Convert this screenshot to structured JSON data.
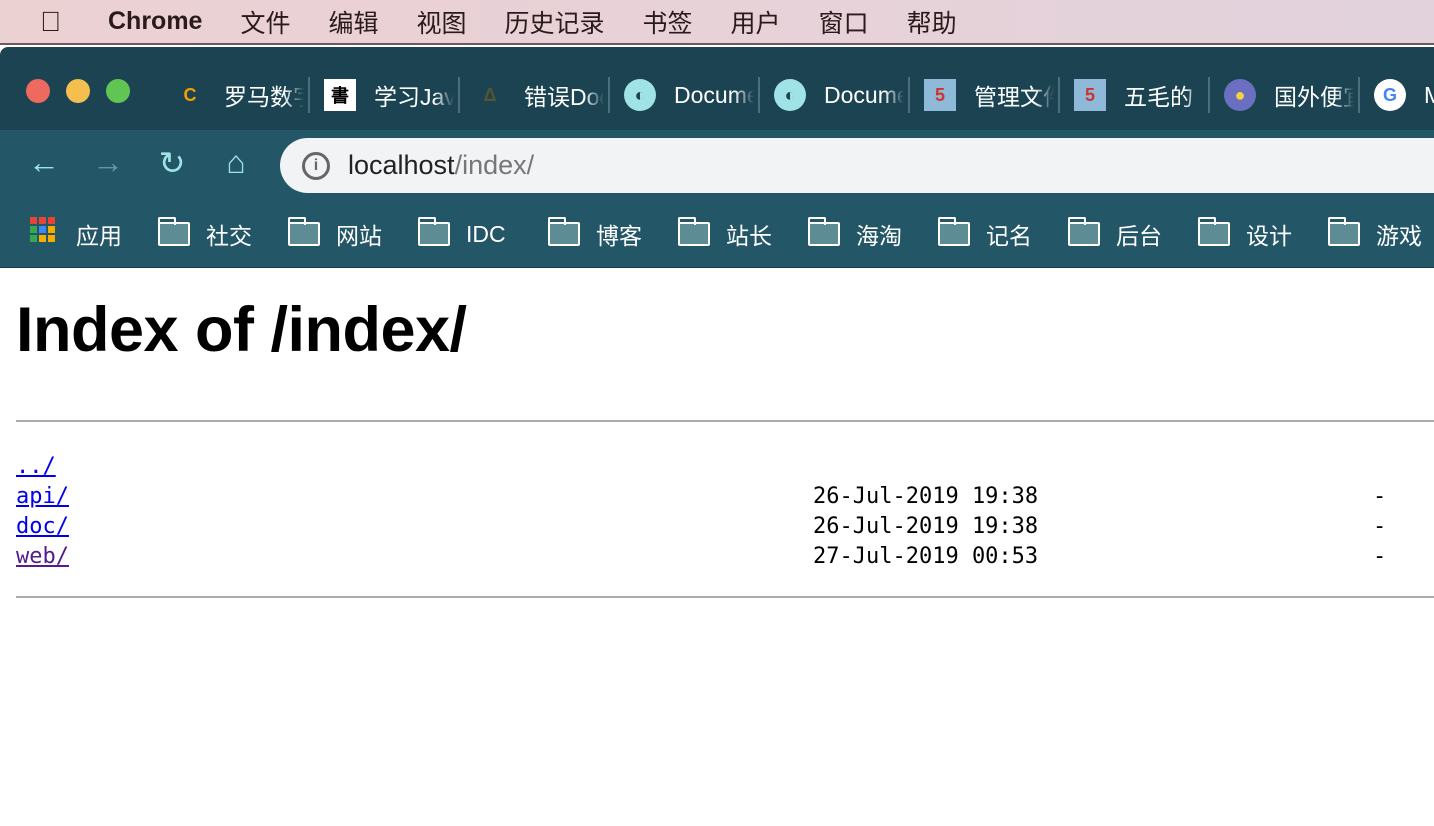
{
  "menubar": {
    "app": "Chrome",
    "items": [
      "文件",
      "编辑",
      "视图",
      "历史记录",
      "书签",
      "用户",
      "窗口",
      "帮助"
    ]
  },
  "tabs": [
    {
      "title": "罗马数字",
      "icon": "leetcode-icon"
    },
    {
      "title": "学习Java",
      "icon": "calligraphy-icon"
    },
    {
      "title": "错误Doc",
      "icon": "error-site-icon"
    },
    {
      "title": "Documentation",
      "icon": "globe-icon"
    },
    {
      "title": "Documentation",
      "icon": "globe-icon"
    },
    {
      "title": "管理文件",
      "icon": "speed-sign-icon"
    },
    {
      "title": "五毛的",
      "icon": "speed-sign-icon"
    },
    {
      "title": "国外便宜",
      "icon": "lightbulb-icon"
    },
    {
      "title": "M",
      "icon": "google-icon"
    }
  ],
  "address": {
    "host": "localhost",
    "path": "/index/"
  },
  "bookmarks": {
    "apps": "应用",
    "folders": [
      "社交",
      "网站",
      "IDC",
      "博客",
      "站长",
      "海淘",
      "记名",
      "后台",
      "设计",
      "游戏"
    ]
  },
  "page": {
    "title": "Index of /index/",
    "parent": "../",
    "entries": [
      {
        "name": "api/",
        "date": "26-Jul-2019 19:38",
        "size": "-"
      },
      {
        "name": "doc/",
        "date": "26-Jul-2019 19:38",
        "size": "-"
      },
      {
        "name": "web/",
        "date": "27-Jul-2019 00:53",
        "size": "-"
      }
    ]
  },
  "colors": {
    "tabstrip": "#1b4352",
    "toolbar": "#235667",
    "link": "#0000ee",
    "visited": "#551a8b"
  }
}
